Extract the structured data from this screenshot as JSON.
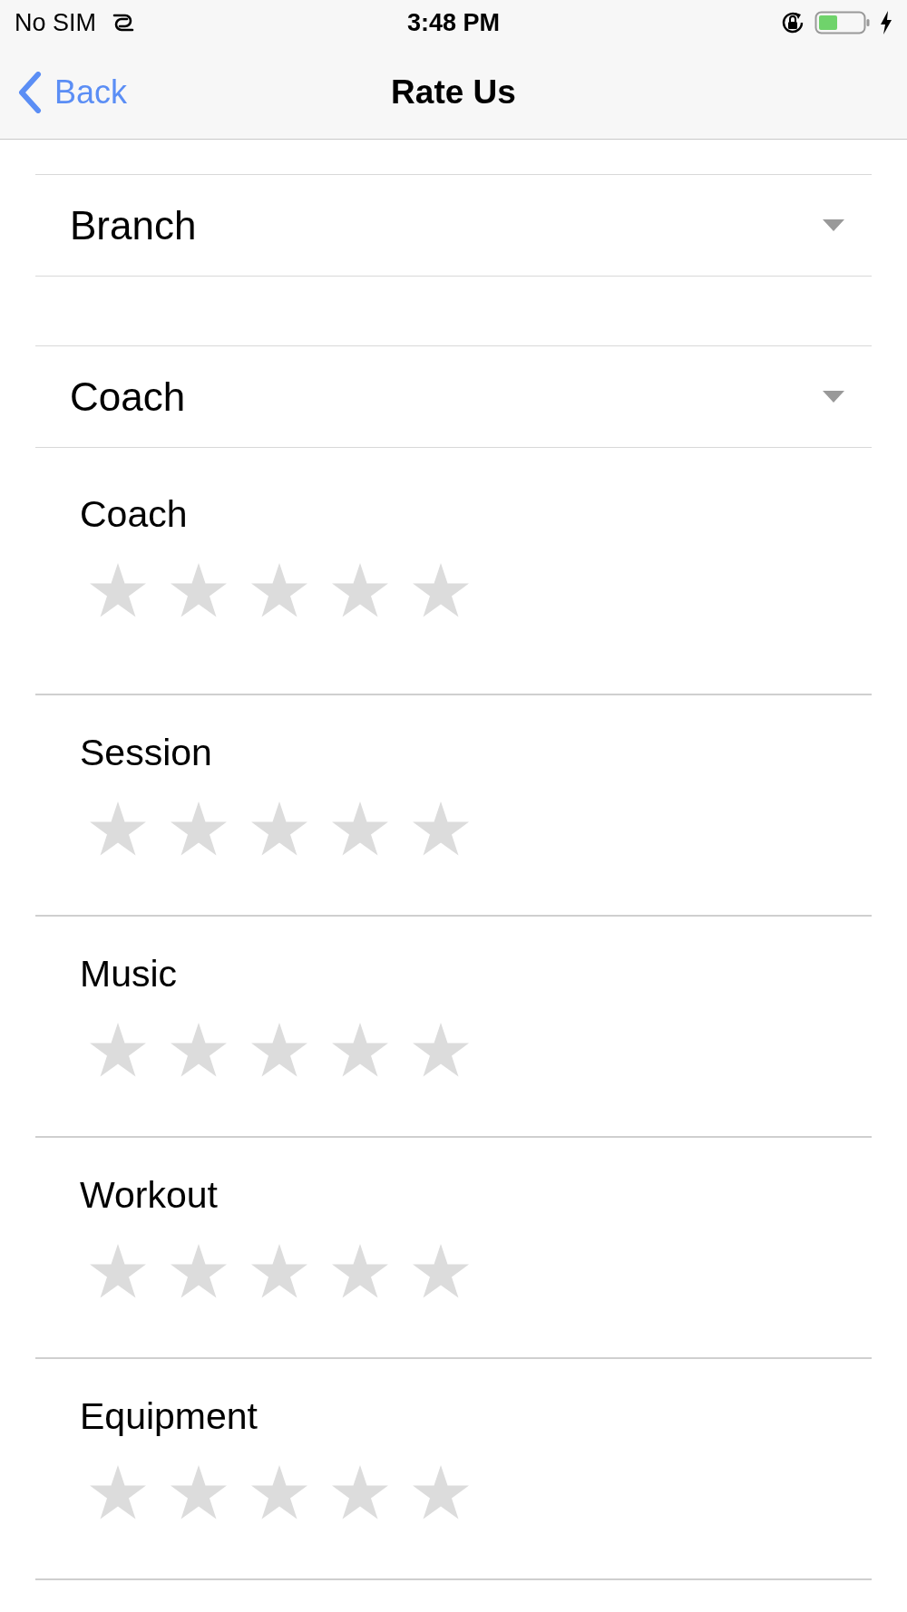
{
  "status_bar": {
    "carrier": "No SIM",
    "time": "3:48 PM"
  },
  "nav_bar": {
    "back": "Back",
    "title": "Rate Us"
  },
  "dropdowns": [
    {
      "label": "Branch"
    },
    {
      "label": "Coach"
    }
  ],
  "ratings": [
    {
      "label": "Coach",
      "stars": 0
    },
    {
      "label": "Session",
      "stars": 0
    },
    {
      "label": "Music",
      "stars": 0
    },
    {
      "label": "Workout",
      "stars": 0
    },
    {
      "label": "Equipment",
      "stars": 0
    }
  ]
}
